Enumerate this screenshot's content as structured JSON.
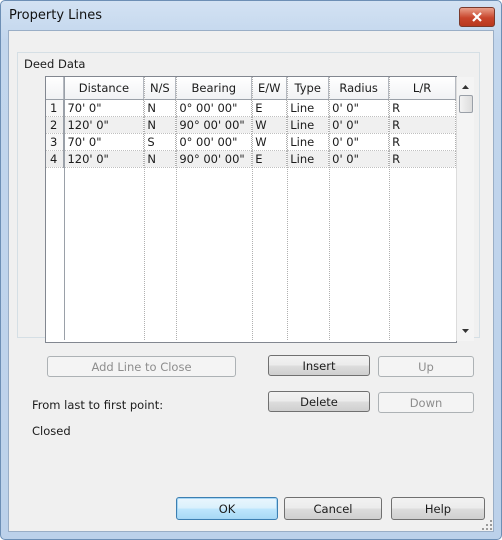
{
  "window": {
    "title": "Property Lines"
  },
  "group": {
    "label": "Deed Data"
  },
  "table": {
    "columns": [
      "Distance",
      "N/S",
      "Bearing",
      "E/W",
      "Type",
      "Radius",
      "L/R"
    ],
    "rows": [
      {
        "num": "1",
        "distance": "70' 0\"",
        "ns": "N",
        "bearing": "0° 00' 00\"",
        "ew": "E",
        "type": "Line",
        "radius": "0' 0\"",
        "lr": "R"
      },
      {
        "num": "2",
        "distance": "120' 0\"",
        "ns": "N",
        "bearing": "90° 00' 00\"",
        "ew": "W",
        "type": "Line",
        "radius": "0' 0\"",
        "lr": "R"
      },
      {
        "num": "3",
        "distance": "70' 0\"",
        "ns": "S",
        "bearing": "0° 00' 00\"",
        "ew": "W",
        "type": "Line",
        "radius": "0' 0\"",
        "lr": "R"
      },
      {
        "num": "4",
        "distance": "120' 0\"",
        "ns": "N",
        "bearing": "90° 00' 00\"",
        "ew": "E",
        "type": "Line",
        "radius": "0' 0\"",
        "lr": "R"
      }
    ]
  },
  "buttons": {
    "add_line": "Add Line to Close",
    "insert": "Insert",
    "up": "Up",
    "delete": "Delete",
    "down": "Down",
    "ok": "OK",
    "cancel": "Cancel",
    "help": "Help"
  },
  "labels": {
    "from_last": "From last to first point:",
    "status": "Closed"
  },
  "icons": {
    "close": "close-icon",
    "scroll_up": "arrow-up-icon",
    "scroll_down": "arrow-down-icon",
    "resize": "resize-grip-icon"
  }
}
